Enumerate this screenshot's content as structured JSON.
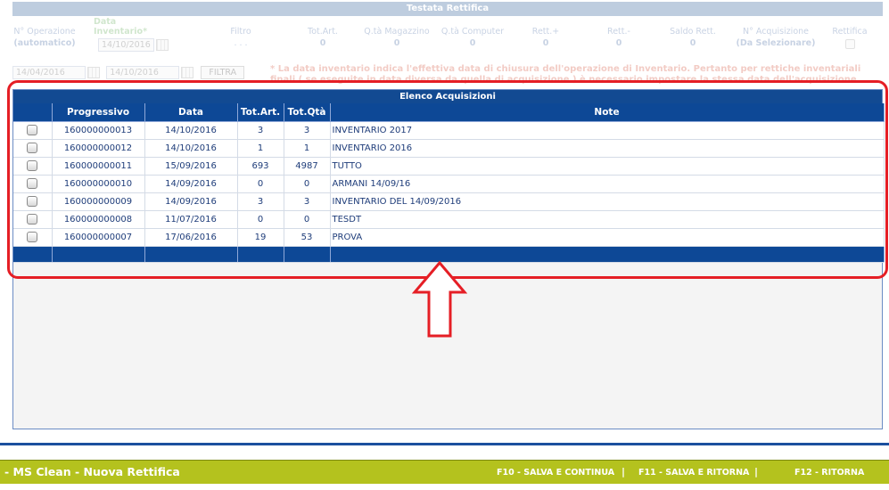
{
  "header": {
    "title": "Testata Rettifica",
    "cols": [
      {
        "label": "N° Operazione",
        "value": "(automatico)"
      },
      {
        "label": "Data Inventario*",
        "value": "14/10/2016"
      },
      {
        "label": "Filtro",
        "value": ". . ."
      },
      {
        "label": "Tot.Art.",
        "value": "0"
      },
      {
        "label": "Q.tà Magazzino",
        "value": "0"
      },
      {
        "label": "Q.tà Computer",
        "value": "0"
      },
      {
        "label": "Rett.+",
        "value": "0"
      },
      {
        "label": "Rett.-",
        "value": "0"
      },
      {
        "label": "Saldo Rett.",
        "value": "0"
      },
      {
        "label": "N° Acquisizione",
        "value": "(Da Selezionare)"
      },
      {
        "label": "Rettifica",
        "value": ""
      }
    ],
    "filter_from": "14/04/2016",
    "filter_to": "14/10/2016",
    "filter_button": "FILTRA",
    "note": "* La data inventario indica l'effettiva data di chiusura dell'operazione di Inventario. Pertanto per rettiche inventariali finali ( se eseguite in data diversa da quella di acquisizione ) è necessario impostare la stessa data dell'acquisizione."
  },
  "panel": {
    "title": "Elenco Acquisizioni",
    "columns": [
      "",
      "Progressivo",
      "Data",
      "Tot.Art.",
      "Tot.Qtà",
      "Note"
    ],
    "rows": [
      {
        "prog": "160000000013",
        "data": "14/10/2016",
        "art": "3",
        "qta": "3",
        "note": "INVENTARIO 2017"
      },
      {
        "prog": "160000000012",
        "data": "14/10/2016",
        "art": "1",
        "qta": "1",
        "note": "INVENTARIO 2016"
      },
      {
        "prog": "160000000011",
        "data": "15/09/2016",
        "art": "693",
        "qta": "4987",
        "note": "TUTTO"
      },
      {
        "prog": "160000000010",
        "data": "14/09/2016",
        "art": "0",
        "qta": "0",
        "note": "ARMANI 14/09/16"
      },
      {
        "prog": "160000000009",
        "data": "14/09/2016",
        "art": "3",
        "qta": "3",
        "note": "INVENTARIO DEL 14/09/2016"
      },
      {
        "prog": "160000000008",
        "data": "11/07/2016",
        "art": "0",
        "qta": "0",
        "note": "TESDT"
      },
      {
        "prog": "160000000007",
        "data": "17/06/2016",
        "art": "19",
        "qta": "53",
        "note": "PROVA"
      }
    ]
  },
  "bottom": {
    "app_title": "- MS Clean - Nuova Rettifica",
    "f10": "F10 - SALVA E CONTINUA",
    "f11": "F11 - SALVA E RITORNA",
    "f12": "F12 - RITORNA",
    "separator": "|"
  },
  "colors": {
    "accent": "#0d4896",
    "highlight": "#e51e25",
    "bar": "#b4c21e"
  }
}
